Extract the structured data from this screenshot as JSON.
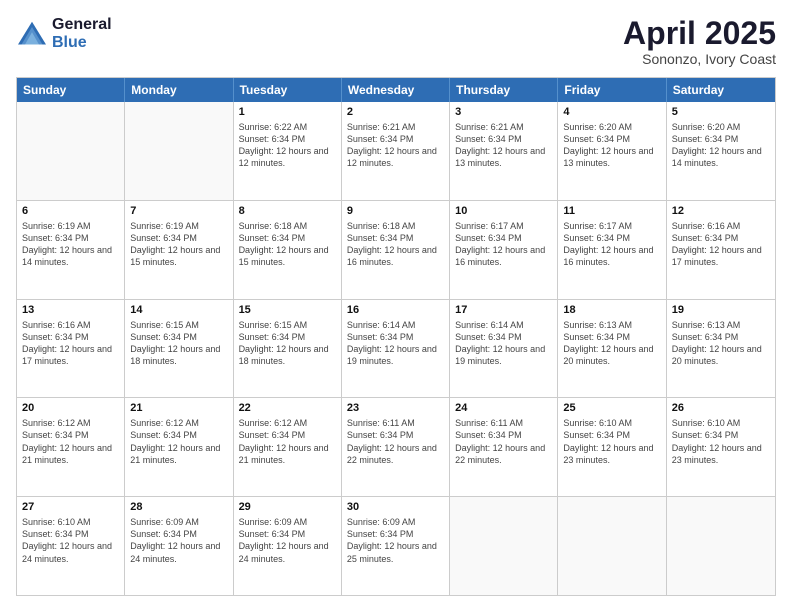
{
  "logo": {
    "line1": "General",
    "line2": "Blue"
  },
  "title": "April 2025",
  "subtitle": "Sononzo, Ivory Coast",
  "weekdays": [
    "Sunday",
    "Monday",
    "Tuesday",
    "Wednesday",
    "Thursday",
    "Friday",
    "Saturday"
  ],
  "rows": [
    [
      {
        "day": "",
        "empty": true
      },
      {
        "day": "",
        "empty": true
      },
      {
        "day": "1",
        "sunrise": "Sunrise: 6:22 AM",
        "sunset": "Sunset: 6:34 PM",
        "daylight": "Daylight: 12 hours and 12 minutes."
      },
      {
        "day": "2",
        "sunrise": "Sunrise: 6:21 AM",
        "sunset": "Sunset: 6:34 PM",
        "daylight": "Daylight: 12 hours and 12 minutes."
      },
      {
        "day": "3",
        "sunrise": "Sunrise: 6:21 AM",
        "sunset": "Sunset: 6:34 PM",
        "daylight": "Daylight: 12 hours and 13 minutes."
      },
      {
        "day": "4",
        "sunrise": "Sunrise: 6:20 AM",
        "sunset": "Sunset: 6:34 PM",
        "daylight": "Daylight: 12 hours and 13 minutes."
      },
      {
        "day": "5",
        "sunrise": "Sunrise: 6:20 AM",
        "sunset": "Sunset: 6:34 PM",
        "daylight": "Daylight: 12 hours and 14 minutes."
      }
    ],
    [
      {
        "day": "6",
        "sunrise": "Sunrise: 6:19 AM",
        "sunset": "Sunset: 6:34 PM",
        "daylight": "Daylight: 12 hours and 14 minutes."
      },
      {
        "day": "7",
        "sunrise": "Sunrise: 6:19 AM",
        "sunset": "Sunset: 6:34 PM",
        "daylight": "Daylight: 12 hours and 15 minutes."
      },
      {
        "day": "8",
        "sunrise": "Sunrise: 6:18 AM",
        "sunset": "Sunset: 6:34 PM",
        "daylight": "Daylight: 12 hours and 15 minutes."
      },
      {
        "day": "9",
        "sunrise": "Sunrise: 6:18 AM",
        "sunset": "Sunset: 6:34 PM",
        "daylight": "Daylight: 12 hours and 16 minutes."
      },
      {
        "day": "10",
        "sunrise": "Sunrise: 6:17 AM",
        "sunset": "Sunset: 6:34 PM",
        "daylight": "Daylight: 12 hours and 16 minutes."
      },
      {
        "day": "11",
        "sunrise": "Sunrise: 6:17 AM",
        "sunset": "Sunset: 6:34 PM",
        "daylight": "Daylight: 12 hours and 16 minutes."
      },
      {
        "day": "12",
        "sunrise": "Sunrise: 6:16 AM",
        "sunset": "Sunset: 6:34 PM",
        "daylight": "Daylight: 12 hours and 17 minutes."
      }
    ],
    [
      {
        "day": "13",
        "sunrise": "Sunrise: 6:16 AM",
        "sunset": "Sunset: 6:34 PM",
        "daylight": "Daylight: 12 hours and 17 minutes."
      },
      {
        "day": "14",
        "sunrise": "Sunrise: 6:15 AM",
        "sunset": "Sunset: 6:34 PM",
        "daylight": "Daylight: 12 hours and 18 minutes."
      },
      {
        "day": "15",
        "sunrise": "Sunrise: 6:15 AM",
        "sunset": "Sunset: 6:34 PM",
        "daylight": "Daylight: 12 hours and 18 minutes."
      },
      {
        "day": "16",
        "sunrise": "Sunrise: 6:14 AM",
        "sunset": "Sunset: 6:34 PM",
        "daylight": "Daylight: 12 hours and 19 minutes."
      },
      {
        "day": "17",
        "sunrise": "Sunrise: 6:14 AM",
        "sunset": "Sunset: 6:34 PM",
        "daylight": "Daylight: 12 hours and 19 minutes."
      },
      {
        "day": "18",
        "sunrise": "Sunrise: 6:13 AM",
        "sunset": "Sunset: 6:34 PM",
        "daylight": "Daylight: 12 hours and 20 minutes."
      },
      {
        "day": "19",
        "sunrise": "Sunrise: 6:13 AM",
        "sunset": "Sunset: 6:34 PM",
        "daylight": "Daylight: 12 hours and 20 minutes."
      }
    ],
    [
      {
        "day": "20",
        "sunrise": "Sunrise: 6:12 AM",
        "sunset": "Sunset: 6:34 PM",
        "daylight": "Daylight: 12 hours and 21 minutes."
      },
      {
        "day": "21",
        "sunrise": "Sunrise: 6:12 AM",
        "sunset": "Sunset: 6:34 PM",
        "daylight": "Daylight: 12 hours and 21 minutes."
      },
      {
        "day": "22",
        "sunrise": "Sunrise: 6:12 AM",
        "sunset": "Sunset: 6:34 PM",
        "daylight": "Daylight: 12 hours and 21 minutes."
      },
      {
        "day": "23",
        "sunrise": "Sunrise: 6:11 AM",
        "sunset": "Sunset: 6:34 PM",
        "daylight": "Daylight: 12 hours and 22 minutes."
      },
      {
        "day": "24",
        "sunrise": "Sunrise: 6:11 AM",
        "sunset": "Sunset: 6:34 PM",
        "daylight": "Daylight: 12 hours and 22 minutes."
      },
      {
        "day": "25",
        "sunrise": "Sunrise: 6:10 AM",
        "sunset": "Sunset: 6:34 PM",
        "daylight": "Daylight: 12 hours and 23 minutes."
      },
      {
        "day": "26",
        "sunrise": "Sunrise: 6:10 AM",
        "sunset": "Sunset: 6:34 PM",
        "daylight": "Daylight: 12 hours and 23 minutes."
      }
    ],
    [
      {
        "day": "27",
        "sunrise": "Sunrise: 6:10 AM",
        "sunset": "Sunset: 6:34 PM",
        "daylight": "Daylight: 12 hours and 24 minutes."
      },
      {
        "day": "28",
        "sunrise": "Sunrise: 6:09 AM",
        "sunset": "Sunset: 6:34 PM",
        "daylight": "Daylight: 12 hours and 24 minutes."
      },
      {
        "day": "29",
        "sunrise": "Sunrise: 6:09 AM",
        "sunset": "Sunset: 6:34 PM",
        "daylight": "Daylight: 12 hours and 24 minutes."
      },
      {
        "day": "30",
        "sunrise": "Sunrise: 6:09 AM",
        "sunset": "Sunset: 6:34 PM",
        "daylight": "Daylight: 12 hours and 25 minutes."
      },
      {
        "day": "",
        "empty": true
      },
      {
        "day": "",
        "empty": true
      },
      {
        "day": "",
        "empty": true
      }
    ]
  ]
}
